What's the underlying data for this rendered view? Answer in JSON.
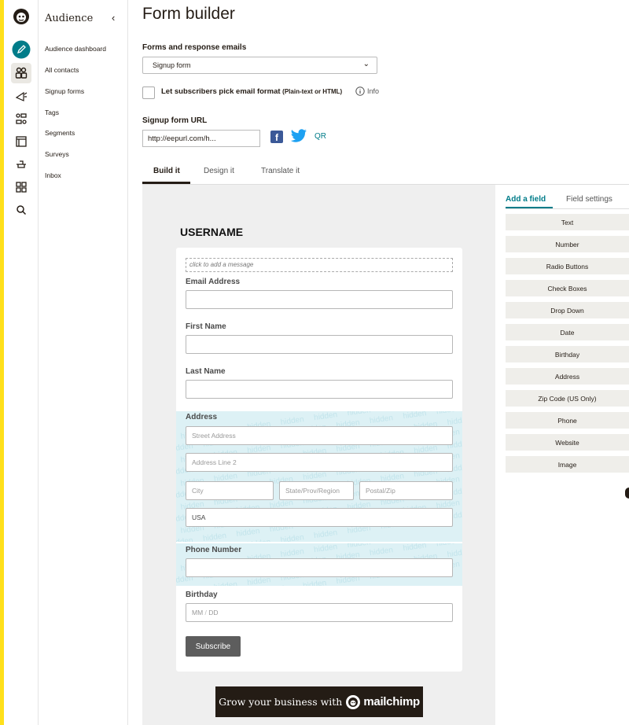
{
  "sidebar": {
    "title": "Audience",
    "collapse_icon": "chevron-left-icon",
    "items": [
      {
        "label": "Audience dashboard"
      },
      {
        "label": "All contacts"
      },
      {
        "label": "Signup forms"
      },
      {
        "label": "Tags"
      },
      {
        "label": "Segments"
      },
      {
        "label": "Surveys"
      },
      {
        "label": "Inbox"
      }
    ]
  },
  "rail_icons": [
    "mailchimp-logo-icon",
    "pencil-icon",
    "audience-icon",
    "campaigns-icon",
    "automations-icon",
    "website-icon",
    "integrations-icon",
    "grid-icon",
    "search-icon"
  ],
  "page": {
    "title": "Form builder",
    "forms_label": "Forms and response emails",
    "forms_select_value": "Signup form",
    "checkbox_label": "Let subscribers pick email format",
    "checkbox_label_small": "(Plain-text or HTML)",
    "info_label": "Info",
    "url_label": "Signup form URL",
    "url_value": "http://eepurl.com/h...",
    "qr_label": "QR"
  },
  "tabs": [
    {
      "label": "Build it",
      "active": true
    },
    {
      "label": "Design it",
      "active": false
    },
    {
      "label": "Translate it",
      "active": false
    }
  ],
  "form": {
    "title": "USERNAME",
    "message_placeholder": "click to add a message",
    "hidden_watermark": "hidden",
    "email_label": "Email Address",
    "first_name_label": "First Name",
    "last_name_label": "Last Name",
    "address_label": "Address",
    "street_placeholder": "Street Address",
    "address2_placeholder": "Address Line 2",
    "city_placeholder": "City",
    "state_placeholder": "State/Prov/Region",
    "zip_placeholder": "Postal/Zip",
    "country_value": "USA",
    "phone_label": "Phone Number",
    "birthday_label": "Birthday",
    "birthday_mm": "MM",
    "birthday_sep": "/",
    "birthday_dd": "DD",
    "subscribe_label": "Subscribe",
    "badge_text": "Grow your business with",
    "badge_brand": "mailchimp"
  },
  "right_panel": {
    "tabs": [
      {
        "label": "Add a field",
        "active": true
      },
      {
        "label": "Field settings",
        "active": false
      }
    ],
    "fields": [
      "Text",
      "Number",
      "Radio Buttons",
      "Check Boxes",
      "Drop Down",
      "Date",
      "Birthday",
      "Address",
      "Zip Code (US Only)",
      "Phone",
      "Website",
      "Image"
    ]
  },
  "colors": {
    "accent_teal": "#007c89",
    "yellow": "#ffe01b",
    "facebook": "#3b5998",
    "twitter": "#1da1f2"
  }
}
